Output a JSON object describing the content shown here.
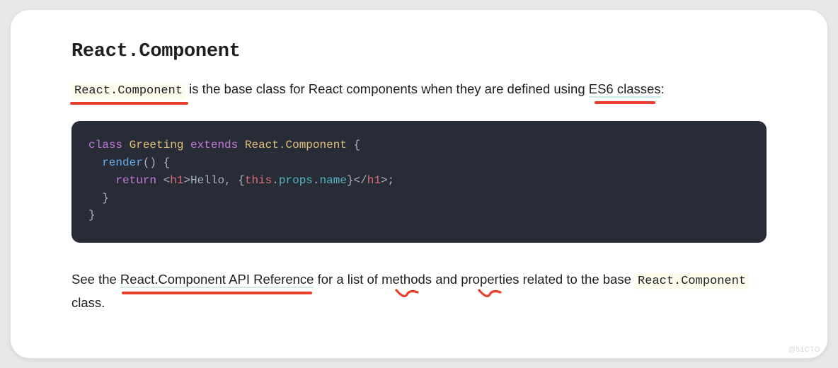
{
  "heading": "React.Component",
  "para1": {
    "code1": "React.Component",
    "middle": " is the base class for React components when they are defined using ",
    "link1": "ES6 classes",
    "tail": ":"
  },
  "code": {
    "l1": {
      "kw1": "class",
      "cls": "Greeting",
      "kw2": "extends",
      "sup1": "React",
      "dot": ".",
      "sup2": "Component",
      "brace": " {"
    },
    "l2": {
      "indent": "  ",
      "fn": "render",
      "paren": "()",
      "brace": " {"
    },
    "l3": {
      "indent": "    ",
      "kw": "return",
      "sp": " ",
      "lt1": "<",
      "tag1": "h1",
      "gt1": ">",
      "txt1": "Hello, ",
      "lb": "{",
      "this": "this",
      "d1": ".",
      "p1": "props",
      "d2": ".",
      "p2": "name",
      "rb": "}",
      "lt2": "</",
      "tag2": "h1",
      "gt2": ">",
      "semi": ";"
    },
    "l4": "  }",
    "l5": "}"
  },
  "para2": {
    "lead": "See the ",
    "link": "React.Component API Reference",
    "mid1": " for a list of ",
    "w1": "methods",
    "mid2": " and ",
    "w2": "properties",
    "mid3": " related to the base ",
    "code": "React.Component",
    "tail": " class."
  },
  "watermark": "@51CTO"
}
